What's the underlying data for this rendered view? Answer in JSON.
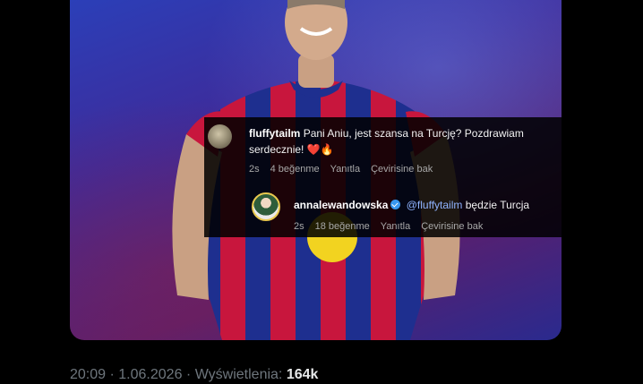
{
  "comments": [
    {
      "username": "fluffytailm",
      "text": "Pani Aniu, jest szansa na Turcję? Pozdrawiam serdecznie!",
      "emoji_heart": "❤️",
      "emoji_fire": "🔥",
      "time": "2s",
      "likes": "4 beğenme",
      "reply_label": "Yanıtla",
      "translate_label": "Çevirisine bak"
    },
    {
      "username": "annalewandowska",
      "mention": "@fluffytailm",
      "text": "będzie Turcja",
      "time": "2s",
      "likes": "18 beğenme",
      "reply_label": "Yanıtla",
      "translate_label": "Çevirisine bak"
    }
  ],
  "footer": {
    "time": "20:09",
    "separator": "·",
    "date": "1.06.2026",
    "views_label": "Wyświetlenia:",
    "views_count": "164k"
  },
  "colors": {
    "background": "#000000",
    "mention": "#8fb3ff",
    "verified": "#3897f0",
    "jersey_red": "#c4163b",
    "jersey_blue": "#1f2e8f"
  }
}
